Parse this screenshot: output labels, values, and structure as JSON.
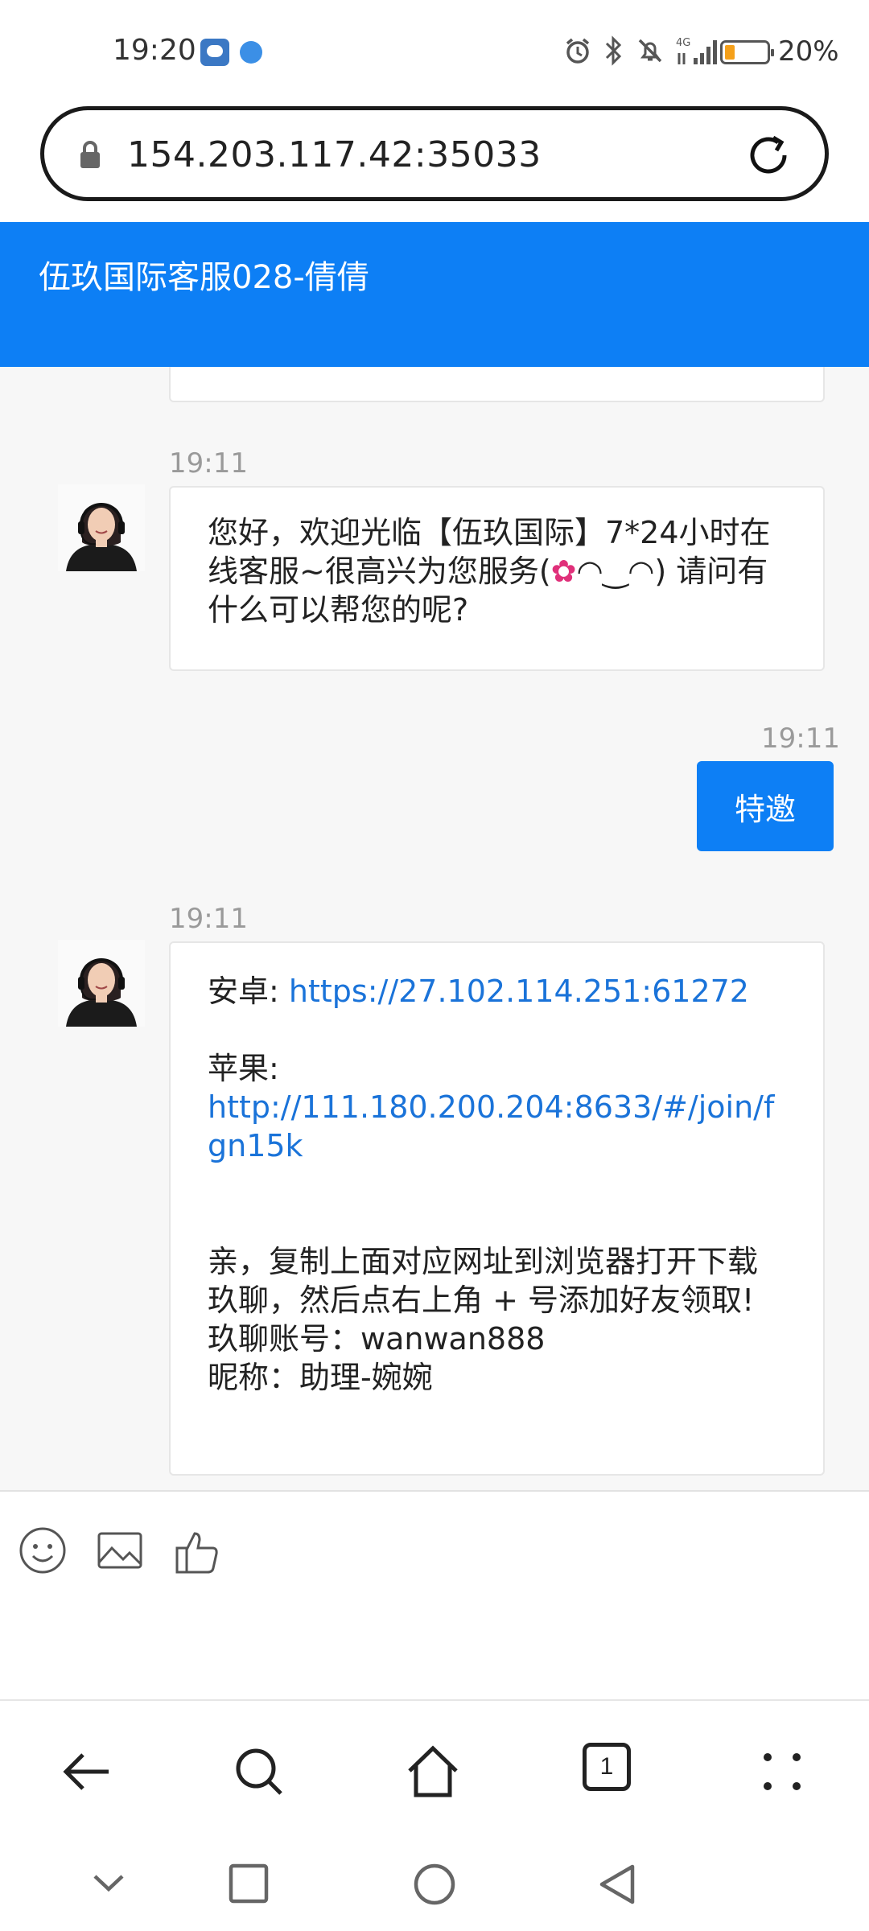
{
  "status_bar": {
    "time": "19:20",
    "battery_text": "20%",
    "battery_level": 0.2,
    "network_label": "4G"
  },
  "browser": {
    "url": "154.203.117.42:35033",
    "tab_count": "1"
  },
  "chat": {
    "title": "伍玖国际客服028-倩倩",
    "messages": [
      {
        "time": "19:11",
        "side": "left",
        "text_part1": "您好，欢迎光临【伍玖国际】7*24小时在线客服~很高兴为您服务(",
        "text_flower": "✿",
        "text_part2": "◠‿◠) 请问有什么可以帮您的呢?"
      },
      {
        "time": "19:11",
        "side": "right",
        "text": "特邀"
      },
      {
        "time": "19:11",
        "side": "left",
        "android_label": "安卓:",
        "android_link": "https://27.102.114.251:61272",
        "ios_label": "苹果:",
        "ios_link": "http://111.180.200.204:8633/#/join/fgn15k",
        "line1": "亲，复制上面对应网址到浏览器打开下载玖聊，然后点右上角 + 号添加好友领取!",
        "line2": "玖聊账号：wanwan888",
        "line3": "昵称：助理-婉婉"
      }
    ]
  },
  "toolbar": {
    "icons": [
      "emoji-icon",
      "image-icon",
      "thumbs-up-icon"
    ]
  },
  "colors": {
    "accent": "#0d7ff5",
    "link": "#1a73d9",
    "battery": "#f5a01a"
  }
}
